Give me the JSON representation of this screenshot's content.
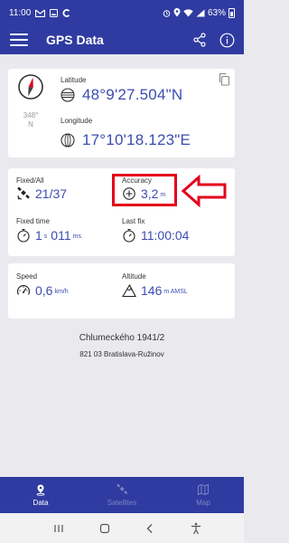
{
  "status_bar": {
    "time": "11:00",
    "battery": "63%"
  },
  "app_bar": {
    "title": "GPS Data"
  },
  "location": {
    "bearing_deg": "348°",
    "bearing_dir": "N",
    "latitude_label": "Latitude",
    "latitude_value": "48°9'27.504\"N",
    "longitude_label": "Longitude",
    "longitude_value": "17°10'18.123\"E"
  },
  "stats": {
    "fixed_label": "Fixed/All",
    "fixed_value": "21/37",
    "accuracy_label": "Accuracy",
    "accuracy_value": "3,2",
    "accuracy_unit": "m",
    "fixed_time_label": "Fixed time",
    "fixed_time_sec": "1",
    "fixed_time_sec_unit": "s",
    "fixed_time_ms": "011",
    "fixed_time_ms_unit": "ms",
    "last_fix_label": "Last fix",
    "last_fix_value": "11:00:04"
  },
  "motion": {
    "speed_label": "Speed",
    "speed_value": "0,6",
    "speed_unit": "km/h",
    "altitude_label": "Altitude",
    "altitude_value": "146",
    "altitude_unit": "m AMSL"
  },
  "address": {
    "line1": "Chlumeckého 1941/2",
    "line2": "821 03 Bratislava-Ružinov"
  },
  "bottom_nav": {
    "items": [
      {
        "label": "Data",
        "active": true
      },
      {
        "label": "Satellites",
        "active": false
      },
      {
        "label": "Map",
        "active": false
      }
    ]
  },
  "colors": {
    "primary": "#2f3ba0",
    "value_blue": "#3b4cb0",
    "highlight_red": "#e4001b"
  }
}
